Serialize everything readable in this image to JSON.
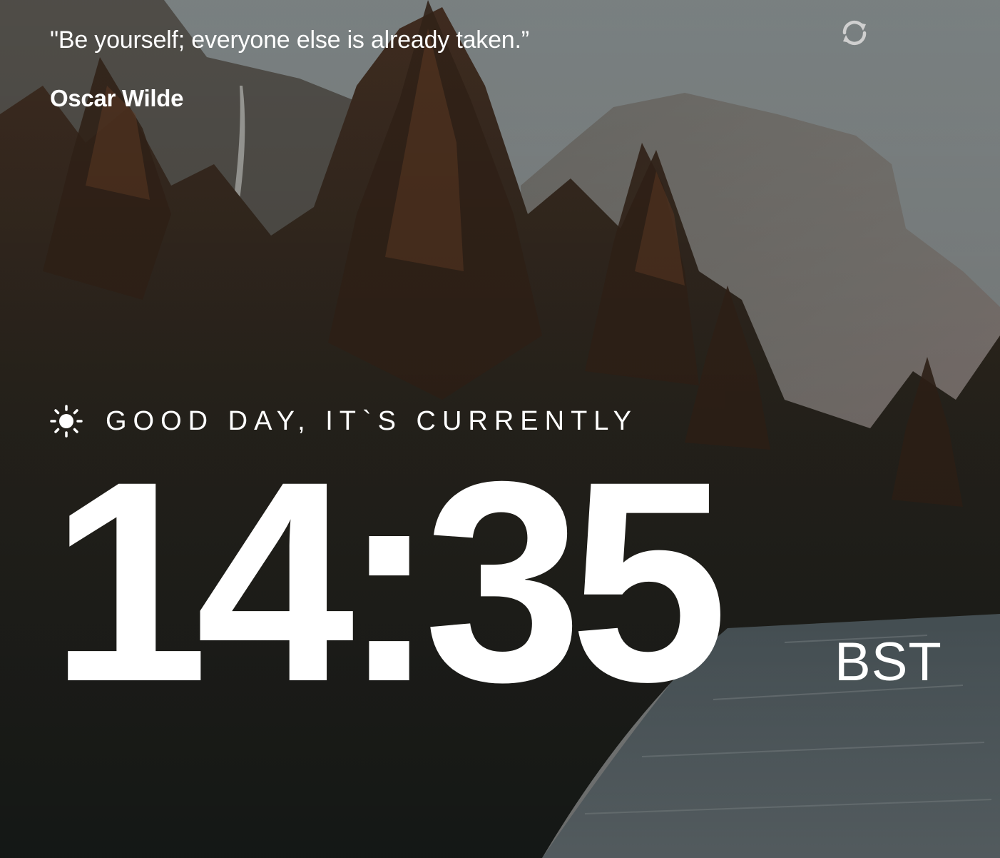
{
  "quote": {
    "text": "\"Be yourself; everyone else is already taken.”",
    "author": "Oscar Wilde"
  },
  "refresh": {
    "icon": "refresh-icon"
  },
  "greeting": {
    "icon": "sun-icon",
    "text": "GOOD DAY, IT`S CURRENTLY"
  },
  "clock": {
    "time": "14:35",
    "timezone": "BST"
  },
  "colors": {
    "text": "#ffffff",
    "refresh_icon": "#cfcfcf"
  }
}
